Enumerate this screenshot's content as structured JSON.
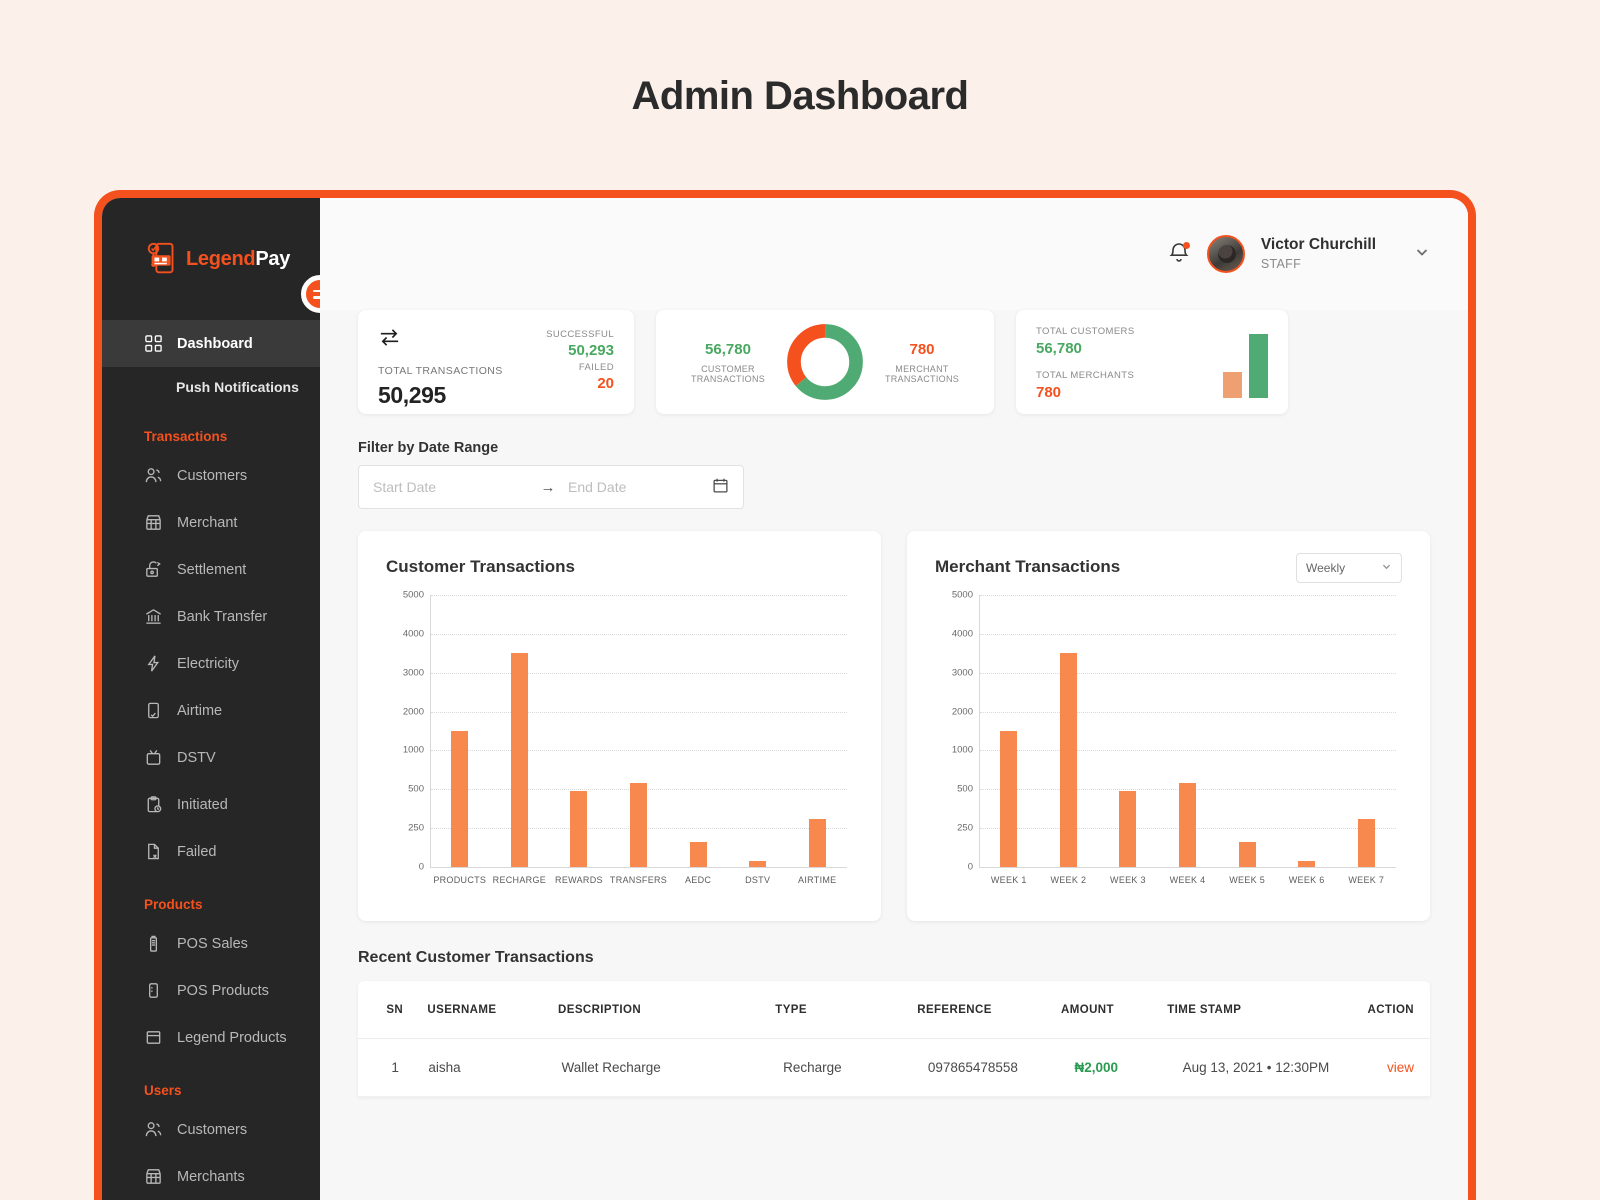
{
  "page": {
    "title": "Admin Dashboard",
    "accent": "#f4511e",
    "background": "#fbf0ea"
  },
  "sidebar": {
    "logo": {
      "legend": "Legend",
      "pay": "Pay"
    },
    "toggle_name": "menu-toggle",
    "primary": [
      {
        "label": "Dashboard",
        "icon": "grid-icon",
        "active": true
      }
    ],
    "sub": [
      {
        "label": "Push Notifications"
      }
    ],
    "groups": [
      {
        "title": "Transactions",
        "items": [
          {
            "label": "Customers",
            "icon": "users-icon"
          },
          {
            "label": "Merchant",
            "icon": "store-icon"
          },
          {
            "label": "Settlement",
            "icon": "settlement-icon"
          },
          {
            "label": "Bank Transfer",
            "icon": "bank-icon"
          },
          {
            "label": "Electricity",
            "icon": "bolt-icon"
          },
          {
            "label": "Airtime",
            "icon": "airtime-icon"
          },
          {
            "label": "DSTV",
            "icon": "tv-icon"
          },
          {
            "label": "Initiated",
            "icon": "clipboard-clock-icon"
          },
          {
            "label": "Failed",
            "icon": "file-x-icon"
          }
        ]
      },
      {
        "title": "Products",
        "items": [
          {
            "label": "POS Sales",
            "icon": "pos-sales-icon"
          },
          {
            "label": "POS Products",
            "icon": "pos-products-icon"
          },
          {
            "label": "Legend Products",
            "icon": "box-icon"
          }
        ]
      },
      {
        "title": "Users",
        "items": [
          {
            "label": "Customers",
            "icon": "users-icon"
          },
          {
            "label": "Merchants",
            "icon": "store-icon"
          }
        ]
      }
    ]
  },
  "topbar": {
    "bell_icon": "bell-icon",
    "has_notification": true,
    "user": {
      "name": "Victor Churchill",
      "role": "STAFF"
    },
    "caret_icon": "chevron-down-icon"
  },
  "cards": {
    "total": {
      "icon": "transfer-icon",
      "label": "TOTAL TRANSACTIONS",
      "value": "50,295",
      "successful_label": "SUCCESSFUL",
      "successful_value": "50,293",
      "failed_label": "FAILED",
      "failed_value": "20",
      "success_color": "#48a860",
      "failed_color": "#f4511e"
    },
    "split": {
      "left_value": "56,780",
      "left_label": "CUSTOMER TRANSACTIONS",
      "right_value": "780",
      "right_label": "MERCHANT TRANSACTIONS"
    },
    "totals": {
      "customers_label": "TOTAL CUSTOMERS",
      "customers_value": "56,780",
      "merchants_label": "TOTAL MERCHANTS",
      "merchants_value": "780"
    }
  },
  "filter": {
    "label": "Filter by Date Range",
    "start_placeholder": "Start Date",
    "end_placeholder": "End Date",
    "arrow": "→",
    "calendar_icon": "calendar-icon"
  },
  "table": {
    "title": "Recent Customer Transactions",
    "headers": [
      "SN",
      "USERNAME",
      "DESCRIPTION",
      "TYPE",
      "REFERENCE",
      "AMOUNT",
      "TIME STAMP",
      "ACTION"
    ],
    "rows": [
      {
        "sn": "1",
        "username": "aisha",
        "description": "Wallet Recharge",
        "type": "Recharge",
        "reference": "097865478558",
        "amount": "₦2,000",
        "timestamp": "Aug 13, 2021 • 12:30PM",
        "action": "view"
      }
    ]
  },
  "chart_data": [
    {
      "type": "bar",
      "title": "Customer Transactions",
      "categories": [
        "PRODUCTS",
        "RECHARGE",
        "REWARDS",
        "TRANSFERS",
        "AEDC",
        "DSTV",
        "AIRTIME"
      ],
      "values": [
        1500,
        3500,
        490,
        580,
        160,
        40,
        310
      ],
      "yticks": [
        0,
        250,
        500,
        1000,
        2000,
        3000,
        4000,
        5000
      ],
      "xlabel": "",
      "ylabel": "",
      "ylim": [
        0,
        5000
      ],
      "grid": true,
      "legend": false,
      "bar_color": "#f7894f"
    },
    {
      "type": "bar",
      "title": "Merchant Transactions",
      "period_selected": "Weekly",
      "categories": [
        "WEEK 1",
        "WEEK 2",
        "WEEK 3",
        "WEEK 4",
        "WEEK 5",
        "WEEK 6",
        "WEEK 7"
      ],
      "values": [
        1500,
        3500,
        490,
        580,
        160,
        40,
        310
      ],
      "yticks": [
        0,
        250,
        500,
        1000,
        2000,
        3000,
        4000,
        5000
      ],
      "xlabel": "",
      "ylabel": "",
      "ylim": [
        0,
        5000
      ],
      "grid": true,
      "legend": false,
      "bar_color": "#f7894f"
    },
    {
      "type": "pie",
      "title": "Customer vs Merchant Transactions",
      "labels": [
        "CUSTOMER TRANSACTIONS",
        "MERCHANT TRANSACTIONS"
      ],
      "values": [
        56780,
        780
      ],
      "display_values": [
        "56,780",
        "780"
      ],
      "arc_fractions": [
        0.64,
        0.36
      ],
      "colors": [
        "#4faa73",
        "#f4511e"
      ],
      "donut": true
    },
    {
      "type": "bar",
      "title": "Customers vs Merchants",
      "categories": [
        "TOTAL MERCHANTS",
        "TOTAL CUSTOMERS"
      ],
      "values": [
        780,
        56780
      ],
      "colors": [
        "#efa073",
        "#4faa73"
      ],
      "ylim": [
        0,
        66000
      ]
    }
  ]
}
